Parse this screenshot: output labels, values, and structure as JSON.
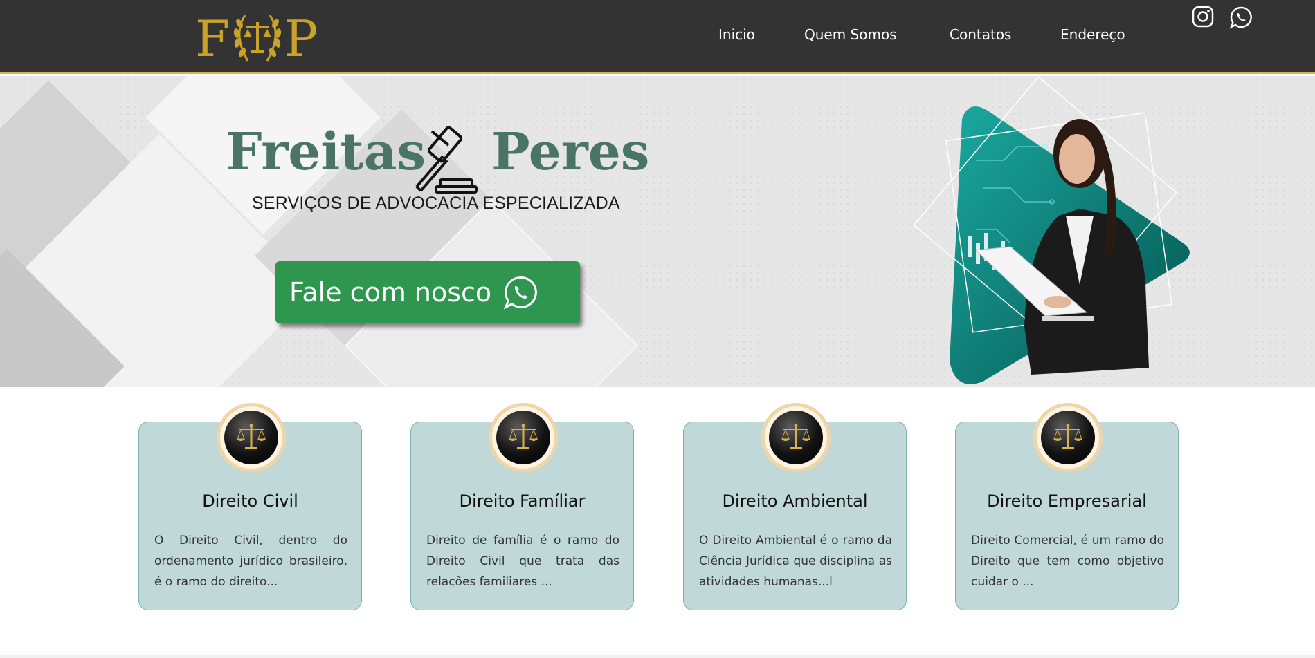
{
  "logo": {
    "letter_left": "F",
    "letter_right": "P"
  },
  "nav": {
    "items": [
      {
        "label": "Inicio"
      },
      {
        "label": "Quem Somos"
      },
      {
        "label": "Contatos"
      },
      {
        "label": "Endereço"
      }
    ]
  },
  "social": {
    "icons": [
      "instagram-icon",
      "whatsapp-icon"
    ]
  },
  "hero": {
    "brand_left": "Freitas",
    "brand_right": "Peres",
    "subtitle": "SERVIÇOS DE ADVOCACIA ESPECIALIZADA",
    "cta_label": "Fale com nosco"
  },
  "cards": [
    {
      "title": "Direito Civil",
      "text": "O Direito Civil, dentro do ordenamento jurídico brasileiro, é o ramo do direito..."
    },
    {
      "title": "Direito Famíliar",
      "text": "Direito de família é o ramo do Direito Civil que trata das relações familiares ..."
    },
    {
      "title": "Direito Ambiental",
      "text": "O Direito Ambiental é o ramo da Ciência Jurídica que disciplina as atividades humanas...l"
    },
    {
      "title": "Direito Empresarial",
      "text": "Direito Comercial, é um ramo do Direito que tem como objetivo cuidar o ..."
    }
  ],
  "colors": {
    "header_bg": "#333333",
    "gold": "#c9a227",
    "brand_green": "#4a7566",
    "cta_green": "#2f9650",
    "card_bg": "#c0d9d8"
  }
}
